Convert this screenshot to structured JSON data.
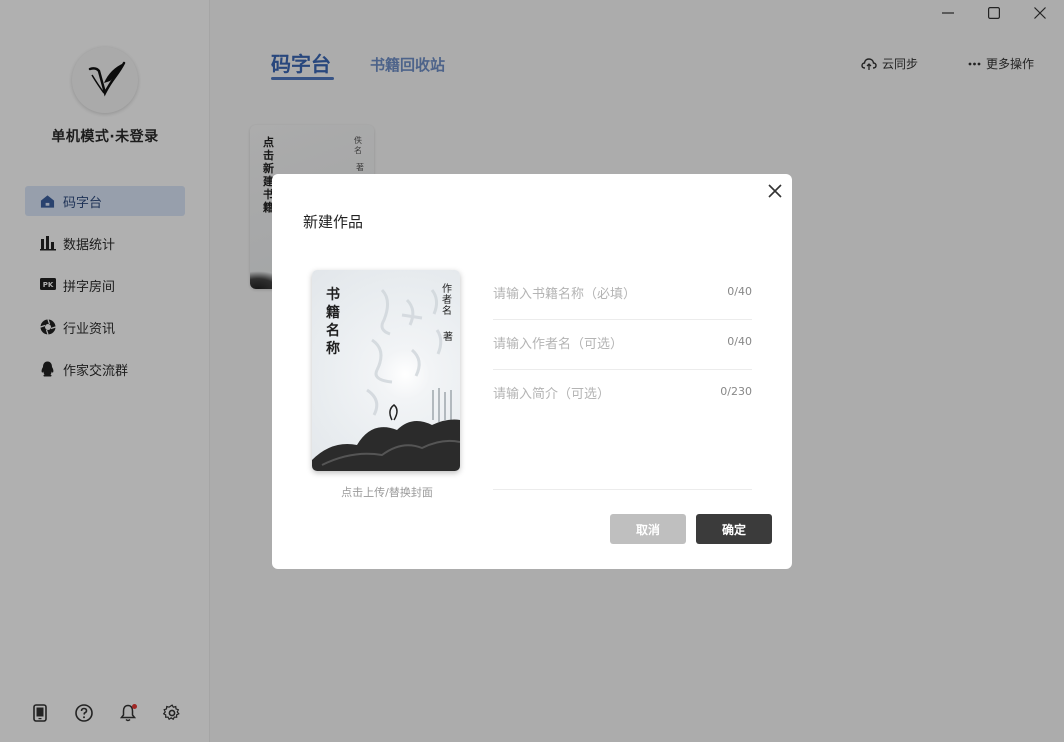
{
  "app": {
    "window_controls": [
      "minimize-icon",
      "maximize-icon",
      "close-icon"
    ]
  },
  "sidebar": {
    "user_name": "单机模式·未登录",
    "items": [
      {
        "label": "码字台",
        "icon": "home-icon",
        "active": true
      },
      {
        "label": "数据统计",
        "icon": "bar-chart-icon",
        "active": false
      },
      {
        "label": "拼字房间",
        "icon": "pk-icon",
        "active": false
      },
      {
        "label": "行业资讯",
        "icon": "aperture-icon",
        "active": false
      },
      {
        "label": "作家交流群",
        "icon": "qq-penguin-icon",
        "active": false
      }
    ],
    "bottom_icons": [
      "tablet-icon",
      "help-icon",
      "bell-icon",
      "gear-icon"
    ]
  },
  "header": {
    "tabs": [
      {
        "label": "码字台",
        "active": true
      },
      {
        "label": "书籍回收站",
        "active": false
      }
    ],
    "actions": {
      "cloud_sync": "云同步",
      "more": "更多操作"
    }
  },
  "book_card": {
    "title": "点击新建书籍",
    "author": "佚名",
    "author_suffix": "著"
  },
  "modal": {
    "title": "新建作品",
    "cover": {
      "title": "书籍名称",
      "author": "作者名",
      "author_suffix": "著",
      "hint": "点击上传/替换封面"
    },
    "fields": {
      "book_name": {
        "placeholder": "请输入书籍名称（必填）",
        "count": "0/40"
      },
      "author_name": {
        "placeholder": "请输入作者名（可选）",
        "count": "0/40"
      },
      "intro": {
        "placeholder": "请输入简介（可选）",
        "count": "0/230"
      }
    },
    "buttons": {
      "cancel": "取消",
      "ok": "确定"
    }
  },
  "colors": {
    "accent": "#3a66b3",
    "active_nav_bg": "#d8e4f6",
    "ok_button": "#3b3b3b",
    "cancel_button": "#bfbfbf"
  }
}
